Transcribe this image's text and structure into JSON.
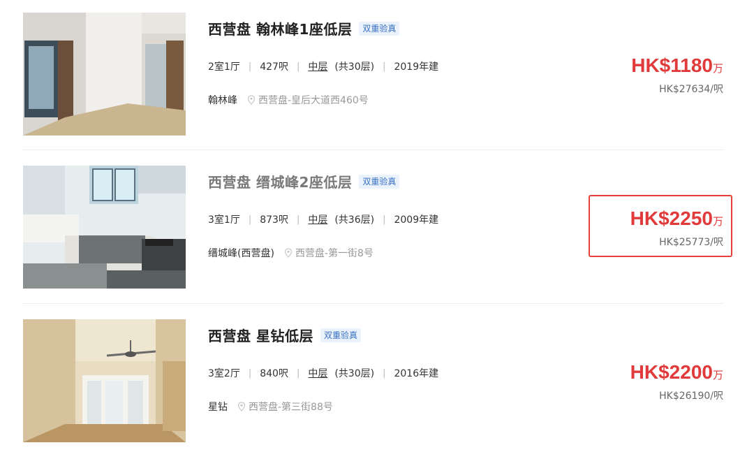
{
  "listings": [
    {
      "title": "西营盘 翰林峰1座低层",
      "badge": "双重验真",
      "layout": "2室1厅",
      "area": "427呎",
      "floor": "中层",
      "floor_total": "(共30层)",
      "built": "2019年建",
      "estate": "翰林峰",
      "location": "西营盘-皇后大道西460号",
      "price": "HK$1180",
      "price_unit": "万",
      "unit_price": "HK$27634/呎",
      "thumb_alt": "living-room-photo"
    },
    {
      "title": "西营盘 缙城峰2座低层",
      "badge": "双重验真",
      "layout": "3室1厅",
      "area": "873呎",
      "floor": "中层",
      "floor_total": "(共36层)",
      "built": "2009年建",
      "estate": "缙城峰(西营盘)",
      "location": "西营盘-第一街8号",
      "price": "HK$2250",
      "price_unit": "万",
      "unit_price": "HK$25773/呎",
      "thumb_alt": "kitchen-photo"
    },
    {
      "title": "西营盘 星钻低层",
      "badge": "双重验真",
      "layout": "3室2厅",
      "area": "840呎",
      "floor": "中层",
      "floor_total": "(共30层)",
      "built": "2016年建",
      "estate": "星钻",
      "location": "西营盘-第三街88号",
      "price": "HK$2200",
      "price_unit": "万",
      "unit_price": "HK$26190/呎",
      "thumb_alt": "room-with-ceiling-fan-photo"
    }
  ],
  "colors": {
    "price": "#e03a3a",
    "badge_text": "#3a72c4",
    "badge_bg": "#eaf2fc",
    "highlight_border": "#e8413b"
  }
}
